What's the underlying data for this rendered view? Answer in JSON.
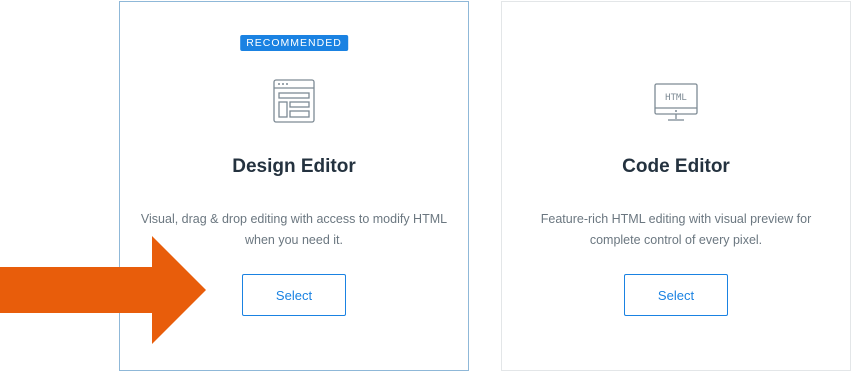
{
  "cards": [
    {
      "badge": "RECOMMENDED",
      "icon": "design-layout-icon",
      "title": "Design Editor",
      "description": "Visual, drag & drop editing with access to modify HTML when you need it.",
      "button_label": "Select",
      "selected": true
    },
    {
      "icon": "html-monitor-icon",
      "icon_text": "HTML",
      "title": "Code Editor",
      "description": "Feature-rich HTML editing with visual preview for complete control of every pixel.",
      "button_label": "Select",
      "selected": false
    }
  ],
  "annotation": {
    "icon": "arrow-right-icon",
    "color": "#e85d0b"
  },
  "colors": {
    "accent": "#1a82e2",
    "selected_border": "#8fb8d8",
    "title": "#24323f",
    "description": "#6b7780",
    "icon_stroke": "#7d8a94"
  }
}
